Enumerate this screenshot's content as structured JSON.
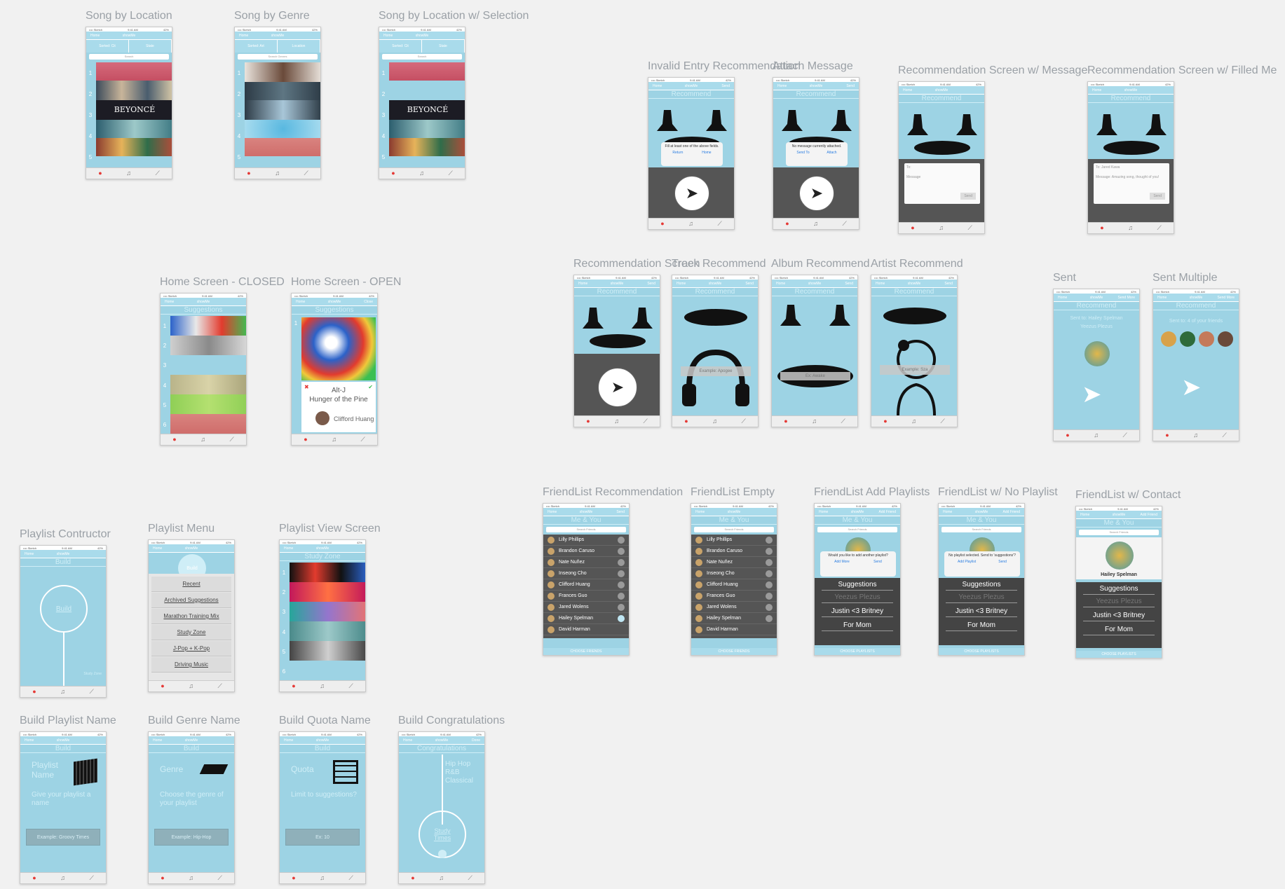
{
  "common": {
    "status_left": "•••• Sketch",
    "status_time": "9:41 AM",
    "status_right": "42%",
    "app_title": "showMe",
    "nav_home": "Home",
    "nav_send": "Send",
    "nav_close": "Close",
    "nav_done": "Done",
    "nav_send_more": "Send More",
    "nav_add_friend": "Add Friend"
  },
  "artboards": {
    "song_by_location": {
      "title": "Song by Location",
      "seg": [
        "Sorted: Cit",
        "State"
      ],
      "search": "Search"
    },
    "song_by_genre": {
      "title": "Song by Genre",
      "seg": [
        "Sorted: Art",
        "Location"
      ],
      "search": "Search Genres"
    },
    "song_by_location_sel": {
      "title": "Song by Location w/ Selection",
      "seg": [
        "Sorted: Cit",
        "State"
      ],
      "search": "Search"
    },
    "invalid_entry": {
      "title": "Invalid Entry Recommendation",
      "section": "Recommend",
      "dialog_text": "Fill at least one of the above fields.",
      "dialog_actions": [
        "Return",
        "Home"
      ]
    },
    "attach_message": {
      "title": "Attach Message",
      "section": "Recommend",
      "dialog_text": "No message currently attached.",
      "dialog_actions": [
        "Send To",
        "Attach"
      ]
    },
    "rec_with_message": {
      "title": "Recommendation Screen w/ Message",
      "section": "Recommend",
      "to": "To:",
      "message": "Message",
      "send": "Send"
    },
    "rec_filled_message": {
      "title": "Recommendation Screen w/ Filled Me",
      "section": "Recommend",
      "to": "To: Jared Kawa",
      "message": "Message: Amazing song, thought of you!",
      "send": "Send"
    },
    "home_closed": {
      "title": "Home Screen - CLOSED",
      "section": "Suggestions"
    },
    "home_open": {
      "title": "Home Screen - OPEN",
      "section": "Suggestions",
      "artist": "Alt-J",
      "song": "Hunger of the Pine",
      "person": "Clifford Huang"
    },
    "rec_screen": {
      "title": "Recommendation Screen",
      "section": "Recommend"
    },
    "track_recommend": {
      "title": "Track Recommend",
      "section": "Recommend",
      "hint": "Example: Apogee"
    },
    "album_recommend": {
      "title": "Album Recommend",
      "section": "Recommend",
      "hint": "Ex: Awake"
    },
    "artist_recommend": {
      "title": "Artist Recommend",
      "section": "Recommend",
      "hint": "Example: Sza"
    },
    "sent": {
      "title": "Sent",
      "section": "Recommend",
      "line1": "Sent to: Hailey Spelman",
      "line2": "Yeezus Plezus"
    },
    "sent_multiple": {
      "title": "Sent Multiple",
      "section": "Recommend",
      "line1": "Sent to: 4 of your friends"
    },
    "friendlist_rec": {
      "title": "FriendList Recommendation",
      "section": "Me & You",
      "search": "Search Friends",
      "footer": "CHOOSE FRIENDS"
    },
    "friendlist_empty": {
      "title": "FriendList Empty",
      "section": "Me & You",
      "search": "Search Friends",
      "footer": "CHOOSE FRIENDS"
    },
    "friendlist_add": {
      "title": "FriendList Add Playlists",
      "section": "Me & You",
      "search": "Search Friends",
      "dialog_text": "Would you like to add another playlist?",
      "dialog_actions": [
        "Add More",
        "Send"
      ],
      "footer": "CHOOSE PLAYLISTS"
    },
    "friendlist_nopl": {
      "title": "FriendList w/ No Playlist",
      "section": "Me & You",
      "search": "Search Friends",
      "dialog_text": "No playlist selected. Send to 'suggestions'?",
      "dialog_actions": [
        "Add Playlist",
        "Send"
      ],
      "footer": "CHOOSE PLAYLISTS"
    },
    "friendlist_contact": {
      "title": "FriendList w/ Contact",
      "section": "Me & You",
      "search": "Search Friends",
      "name": "Hailey Spelman",
      "footer": "CHOOSE PLAYLISTS"
    },
    "playlist_constructor": {
      "title": "Playlist Contructor",
      "section": "Build",
      "circle": "Build",
      "hint": "Study Zone"
    },
    "playlist_menu": {
      "title": "Playlist Menu",
      "circle": "Build",
      "items": [
        "Recent",
        "Archived Suggestions",
        "Marathon Training Mix",
        "Study Zone",
        "J-Pop + K-Pop",
        "Driving Music"
      ]
    },
    "playlist_view": {
      "title": "Playlist View Screen",
      "section": "Study Zone"
    },
    "build_playlist_name": {
      "title": "Build Playlist Name",
      "section": "Build",
      "label": "Playlist Name",
      "hint": "Give your playlist a name",
      "button": "Example: Groovy Times"
    },
    "build_genre_name": {
      "title": "Build Genre Name",
      "section": "Build",
      "label": "Genre",
      "hint": "Choose the genre of your playlist",
      "button": "Example: Hip-Hop"
    },
    "build_quota_name": {
      "title": "Build Quota Name",
      "section": "Build",
      "label": "Quota",
      "hint": "Limit to suggestions?",
      "button": "Ex: 10"
    },
    "build_congrats": {
      "title": "Build Congratulations",
      "section": "Congratulations",
      "genres": "Hip Hop R&B Classical",
      "circle": "Study Times"
    }
  },
  "playlists": [
    "Suggestions",
    "Yeezus Plezus",
    "Justin <3 Britney",
    "For Mom"
  ],
  "friends": [
    "Lilly Phillips",
    "Brandon Caruso",
    "Nate Nuñez",
    "Inseong Cho",
    "Clifford Huang",
    "Frances Guo",
    "Jared Wolens",
    "Hailey Spelman",
    "David Harman"
  ],
  "colors": {
    "screen_bg": "#9dd3e4",
    "nav_bg": "#a9dbeb",
    "dark": "#555555",
    "tab_bar": "#eeeeee",
    "record_red": "#e53935"
  },
  "icons": [
    "home-icon",
    "headphones-icon",
    "chart-icon",
    "turntable-icon",
    "paper-plane-icon",
    "vinyl-icon",
    "person-icon",
    "cube-icon",
    "stack-icon",
    "abacus-icon"
  ]
}
